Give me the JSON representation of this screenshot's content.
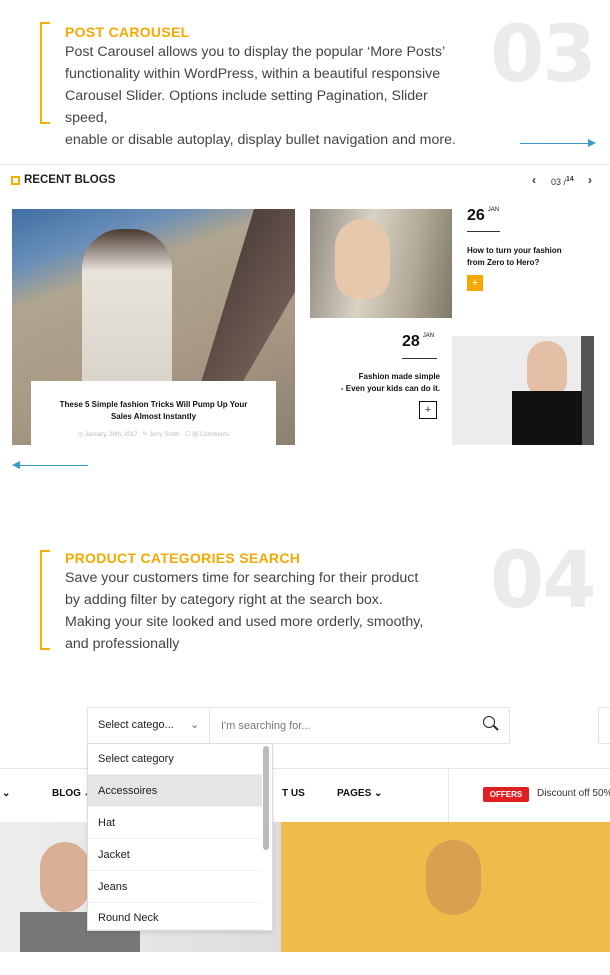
{
  "feature3": {
    "title": "POST CAROUSEL",
    "number": "03",
    "lines": [
      "Post Carousel allows you to display the popular ‘More Posts’",
      "functionality within WordPress, within a beautiful responsive",
      "Carousel Slider. Options include setting Pagination, Slider speed,",
      "enable or disable autoplay, display bullet navigation and more."
    ]
  },
  "blogs": {
    "heading": "RECENT BLOGS",
    "page_current": "03 /",
    "page_total": "14",
    "main": {
      "title_line1": "These 5 Simple fashion Tricks Will Pump Up Your",
      "title_line2": "Sales Almost Instantly",
      "date": "January, 26th, 2017",
      "author": "Jerry Smith",
      "comments": "36 Comments"
    },
    "post2": {
      "day": "26",
      "month": "JAN",
      "title_line1": "How to turn your fashion",
      "title_line2": "from Zero to Hero?",
      "more": "+"
    },
    "post3": {
      "day": "28",
      "month": "JAN",
      "title_line1": "Fashion made simple",
      "title_line2": "- Even your kids can do it.",
      "more": "+"
    }
  },
  "feature4": {
    "title": "PRODUCT CATEGORIES SEARCH",
    "number": "04",
    "lines": [
      "Save your customers time for searching for their product",
      "by adding filter by category right at the search box.",
      "Making your site looked and used more orderly, smoothy,",
      "and professionally"
    ]
  },
  "search": {
    "category_selected": "Select catego...",
    "placeholder": "I'm searching for...",
    "options": [
      "Select category",
      "Accessoires",
      "Hat",
      "Jacket",
      "Jeans",
      "Round Neck"
    ],
    "highlighted": 1
  },
  "nav": {
    "blog": "BLOG",
    "contact": "T US",
    "pages": "PAGES",
    "offers_badge": "OFFERS",
    "offers_text": "Discount off 50%"
  },
  "colors": {
    "accent": "#f5a800",
    "arrow": "#3a9cc4",
    "offers": "#e02020",
    "banner": "#f0bb4a"
  }
}
